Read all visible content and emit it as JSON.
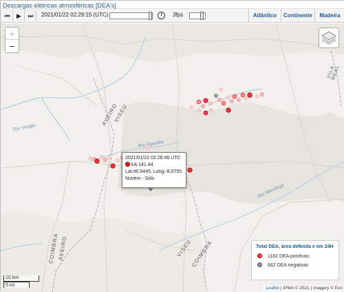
{
  "header": {
    "title": "Descargas elétricas atmosféricas [DEA's]"
  },
  "toolbar": {
    "datetime": "2021/01/22 02:29:15 (UTC)",
    "fps": "3fps",
    "time_slider_progress": 0.97,
    "fps_slider_progress": 0.75,
    "tabs": [
      {
        "label": "Atlântico"
      },
      {
        "label": "Continente"
      },
      {
        "label": "Madeira"
      }
    ]
  },
  "map": {
    "zoom_in": "+",
    "zoom_out": "−",
    "labels": [
      {
        "text": "Rio Vouga"
      },
      {
        "text": "AVEIRO"
      },
      {
        "text": "VISEU"
      },
      {
        "text": "Rio Águeda"
      },
      {
        "text": "Rio Mondego"
      },
      {
        "text": "COIMBRA"
      },
      {
        "text": "AVEIRO"
      },
      {
        "text": "VISEU"
      },
      {
        "text": "COIMBRA"
      },
      {
        "text": "VILA REAL"
      }
    ]
  },
  "popup": {
    "time": "2021/01/22 02:26:46 UTC",
    "ka": "kA:141.44",
    "coords": "Lat:40.5445, Long:-8.0755",
    "type": "Nuvem - Solo"
  },
  "legend": {
    "title": "Total DEA, área definida e em 24H",
    "positive": "1182 DEA positivas",
    "negative": "662 DEA negativas",
    "positive_color": "#e44444",
    "negative_color": "#8a96a8"
  },
  "scale": {
    "km": "10 km",
    "mi": "5 mi"
  },
  "attribution": {
    "leaflet": "Leaflet",
    "rest": " | IPMA © 2021 | Imagery © Esri"
  }
}
